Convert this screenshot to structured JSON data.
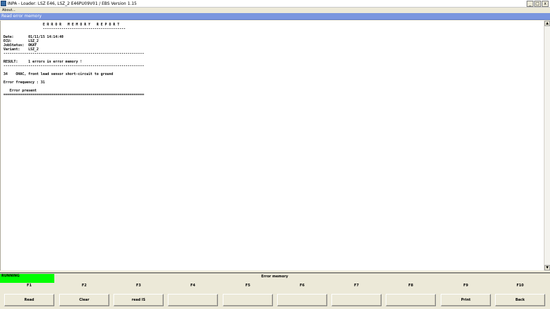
{
  "window": {
    "title": "INPA - Loader: LSZ E46, LSZ_2 E46PU09V01 / EBS Version 1.15",
    "controls": [
      "_",
      "□",
      "x"
    ]
  },
  "menu": {
    "about": "About..."
  },
  "panel": {
    "title": "Read error memory"
  },
  "report": {
    "lines": [
      "                   E R R O R   M E M O R Y   R E P O R T",
      "                   ----------------------------------------",
      "",
      "Date:       01/11/15 14:14:40",
      "ECU:        LSZ_2",
      "JobStatus:  OKAY",
      "Variant:    LSZ_2",
      "--------------------------------------------------------------------",
      "",
      "RESULT:     1 errors in error memory !",
      "--------------------------------------------------------------------",
      "",
      "34    OHAC, front lead sensor short-circuit to ground",
      "",
      "Error frequency : 31",
      "",
      "   Error present",
      "===================================================================="
    ]
  },
  "status": {
    "running": "RUNNING",
    "title": "Error memory"
  },
  "fkeys": [
    {
      "key": "F1",
      "label": "Read"
    },
    {
      "key": "F2",
      "label": "Clear"
    },
    {
      "key": "F3",
      "label": "read IS"
    },
    {
      "key": "F4",
      "label": ""
    },
    {
      "key": "F5",
      "label": ""
    },
    {
      "key": "F6",
      "label": ""
    },
    {
      "key": "F7",
      "label": ""
    },
    {
      "key": "F8",
      "label": ""
    },
    {
      "key": "F9",
      "label": "Print"
    },
    {
      "key": "F10",
      "label": "Back"
    }
  ],
  "colors": {
    "running": "#00ff00",
    "panel_header": "#7a96df"
  }
}
